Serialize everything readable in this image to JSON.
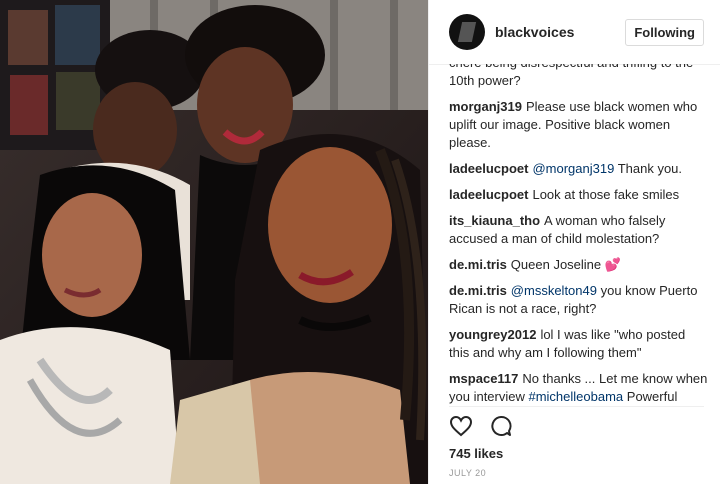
{
  "header": {
    "username": "blackvoices",
    "follow_label": "Following"
  },
  "comments": [
    {
      "user": "",
      "parts": [
        {
          "t": "chere being disrespectful and trifling to the 10th power?"
        }
      ]
    },
    {
      "user": "morganj319",
      "parts": [
        {
          "t": "Please use black women who uplift our image. Positive black women please."
        }
      ]
    },
    {
      "user": "ladeelucpoet",
      "parts": [
        {
          "t": "@morganj319",
          "m": true
        },
        {
          "t": " Thank you."
        }
      ]
    },
    {
      "user": "ladeelucpoet",
      "parts": [
        {
          "t": "Look at those fake smiles"
        }
      ]
    },
    {
      "user": "its_kiauna_tho",
      "parts": [
        {
          "t": "A woman who falsely accused a man of child molestation?"
        }
      ]
    },
    {
      "user": "de.mi.tris",
      "parts": [
        {
          "t": "Queen Joseline "
        },
        {
          "t": "💕",
          "e": true
        }
      ]
    },
    {
      "user": "de.mi.tris",
      "parts": [
        {
          "t": "@msskelton49",
          "m": true
        },
        {
          "t": " you know Puerto Rican is not a race, right?"
        }
      ]
    },
    {
      "user": "youngrey2012",
      "parts": [
        {
          "t": "lol I was like \"who posted this and why am I following them\""
        }
      ]
    },
    {
      "user": "mspace117",
      "parts": [
        {
          "t": "No thanks ... Let me know when you interview "
        },
        {
          "t": "#michelleobama",
          "m": true
        },
        {
          "t": " Powerful BLACK WOMAN who many of us can relate to. Sorry I can't relate to TRASH"
        }
      ]
    }
  ],
  "footer": {
    "likes": "745 likes",
    "date": "JULY 20"
  },
  "icons": {
    "like": "heart-icon",
    "comment": "comment-icon"
  },
  "colors": {
    "mention": "#003569",
    "text": "#262626",
    "muted": "#999999"
  }
}
